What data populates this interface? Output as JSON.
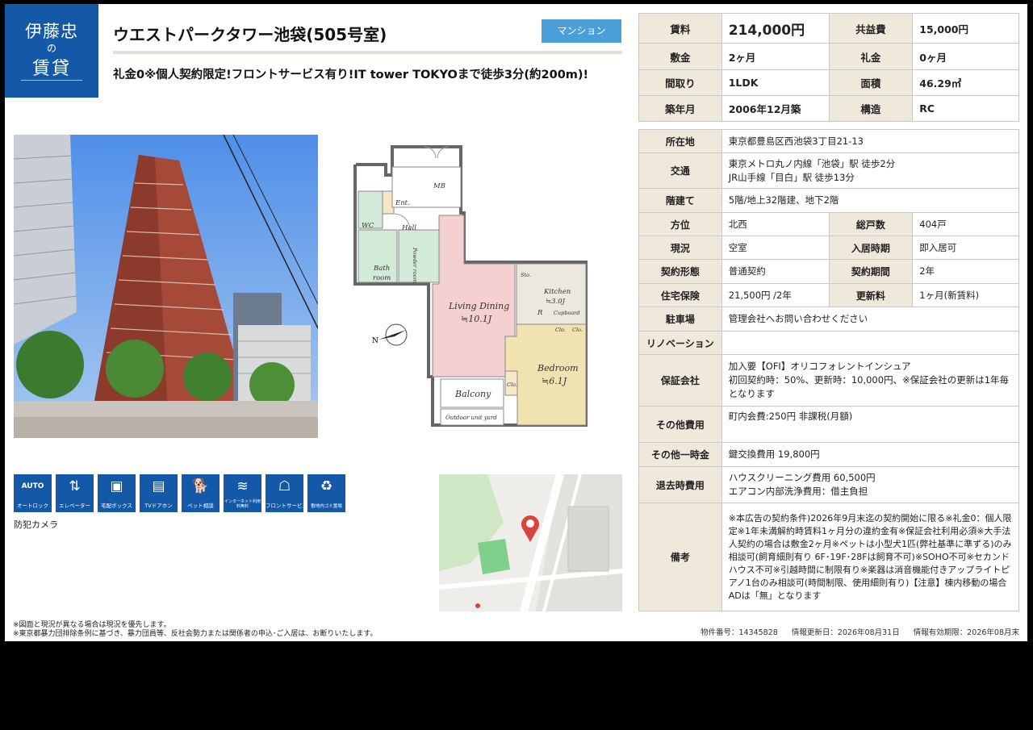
{
  "logo": {
    "line1": "伊藤忠",
    "line2": "の",
    "line3": "賃貸"
  },
  "title": "ウエストパークタワー池袋(505号室)",
  "type_badge": "マンション",
  "catchcopy": "礼金0※個人契約限定!フロントサービス有り!IT tower TOKYOまで徒歩3分(約200m)!",
  "summary": {
    "rent_label": "賃料",
    "rent": "214,000円",
    "common_fee_label": "共益費",
    "common_fee": "15,000円",
    "deposit_label": "敷金",
    "deposit": "2ヶ月",
    "key_money_label": "礼金",
    "key_money": "0ヶ月",
    "layout_label": "間取り",
    "layout": "1LDK",
    "area_label": "面積",
    "area": "46.29㎡",
    "built_label": "築年月",
    "built": "2006年12月築",
    "structure_label": "構造",
    "structure": "RC"
  },
  "details": {
    "address_label": "所在地",
    "address": "東京都豊島区西池袋3丁目21-13",
    "access_label": "交通",
    "access_1": "東京メトロ丸ノ内線「池袋」駅 徒歩2分",
    "access_2": "JR山手線「目白」駅 徒歩13分",
    "floor_label": "階建て",
    "floor": "5階/地上32階建、地下2階",
    "direction_label": "方位",
    "direction": "北西",
    "units_label": "総戸数",
    "units": "404戸",
    "status_label": "現況",
    "status": "空室",
    "move_in_label": "入居時期",
    "move_in": "即入居可",
    "contract_type_label": "契約形態",
    "contract_type": "普通契約",
    "contract_term_label": "契約期間",
    "contract_term": "2年",
    "insurance_label": "住宅保険",
    "insurance": "21,500円 /2年",
    "renewal_label": "更新料",
    "renewal": "1ヶ月(新賃料)",
    "parking_label": "駐車場",
    "parking": "管理会社へお問い合わせください",
    "renovation_label": "リノベーション",
    "renovation": "",
    "guarantor_label": "保証会社",
    "guarantor_1": "加入要【OFI】オリコフォレントインシュア",
    "guarantor_2": "初回契約時：50%、更新時：10,000円、※保証会社の更新は1年毎となります",
    "other_fee_label": "その他費用",
    "other_fee": "町内会費:250円 非課税(月額)",
    "other_once_label": "その他一時金",
    "other_once": "鍵交換費用 19,800円",
    "moveout_label": "退去時費用",
    "moveout_1": "ハウスクリーニング費用 60,500円",
    "moveout_2": "エアコン内部洗浄費用：借主負担",
    "remarks_label": "備考",
    "remarks": "※本広告の契約条件)2026年9月末迄の契約開始に限る※礼金0：個人限定※1年未満解約時賃料1ヶ月分の違約金有※保証会社利用必須※大手法人契約の場合は敷金2ヶ月※ペットは小型犬1匹(弊社基準に準ずる)のみ相談可(飼育細則有り 6F･19F･28Fは飼育不可)※SOHO不可※セカンドハウス不可※引越時間に制限有り※楽器は消音機能付きアップライトピアノ1台のみ相談可(時間制限、使用細則有り)【注意】棟内移動の場合ADは「無」となります"
  },
  "floorplan": {
    "mb": "MB",
    "ent": "Ent.",
    "wc": "WC",
    "hall": "Hall",
    "bath": "Bath",
    "room": "room",
    "powder": "Powder room",
    "living": "Living Dining",
    "living_size": "≒10.1J",
    "kitchen": "Kitchen",
    "kitchen_size": "≒3.0J",
    "cupboard": "Cupboard",
    "clo": "Clo.",
    "sto": "Sto.",
    "r": "R",
    "bedroom": "Bedroom",
    "bedroom_size": "≒6.1J",
    "balcony": "Balcony",
    "outdoor": "Outdoor unit yard"
  },
  "amenities": [
    {
      "icon": "auto-lock-icon",
      "label": "オートロック",
      "sym": "AUTO"
    },
    {
      "icon": "elevator-icon",
      "label": "エレベーター",
      "sym": "⇅"
    },
    {
      "icon": "delivery-box-icon",
      "label": "宅配ボックス",
      "sym": "▣"
    },
    {
      "icon": "tv-intercom-icon",
      "label": "TVドアホン",
      "sym": "▤"
    },
    {
      "icon": "pet-icon",
      "label": "ペット相談",
      "sym": "🐕"
    },
    {
      "icon": "internet-icon",
      "label": "インターネット利用料無料",
      "sym": "≋"
    },
    {
      "icon": "front-service-icon",
      "label": "フロントサービス",
      "sym": "☖"
    },
    {
      "icon": "garbage-icon",
      "label": "敷地内ゴミ置場",
      "sym": "♻"
    }
  ],
  "security_camera": "防犯カメラ",
  "notes": {
    "note1": "※図面と現況が異なる場合は現況を優先します。",
    "note2": "※東京都暴力団排除条例に基づき、暴力団員等、反社会勢力または関係者の申込･ご入居は、お断りいたします。"
  },
  "footer": {
    "property_no": "物件番号：14345828",
    "updated": "情報更新日：2026年08月31日",
    "valid": "情報有効期限：2026年08月末"
  },
  "colors": {
    "brand_blue": "#1458a8",
    "badge_blue": "#4a9fd8",
    "header_beige": "#efe9dc"
  }
}
